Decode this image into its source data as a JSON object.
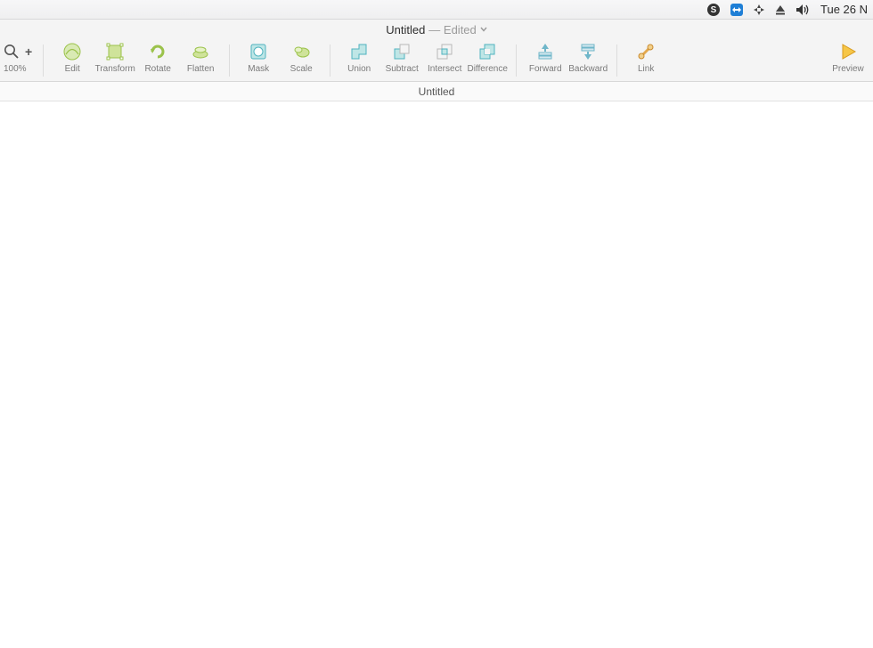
{
  "menubar": {
    "clock": "Tue 26 N",
    "icons": {
      "skype": "skype-icon",
      "teamviewer": "teamviewer-icon",
      "sync": "sync-icon",
      "eject": "eject-icon",
      "volume": "volume-icon"
    }
  },
  "window": {
    "title": "Untitled",
    "suffix": "— Edited"
  },
  "toolbar": {
    "zoom_level": "100%",
    "groups": {
      "edit": {
        "edit": "Edit",
        "transform": "Transform",
        "rotate": "Rotate",
        "flatten": "Flatten"
      },
      "mask": {
        "mask": "Mask",
        "scale": "Scale"
      },
      "boolean": {
        "union": "Union",
        "subtract": "Subtract",
        "intersect": "Intersect",
        "difference": "Difference"
      },
      "order": {
        "forward": "Forward",
        "backward": "Backward"
      },
      "link": {
        "link": "Link"
      },
      "preview": {
        "preview": "Preview"
      }
    }
  },
  "tabstrip": {
    "page_name": "Untitled"
  }
}
